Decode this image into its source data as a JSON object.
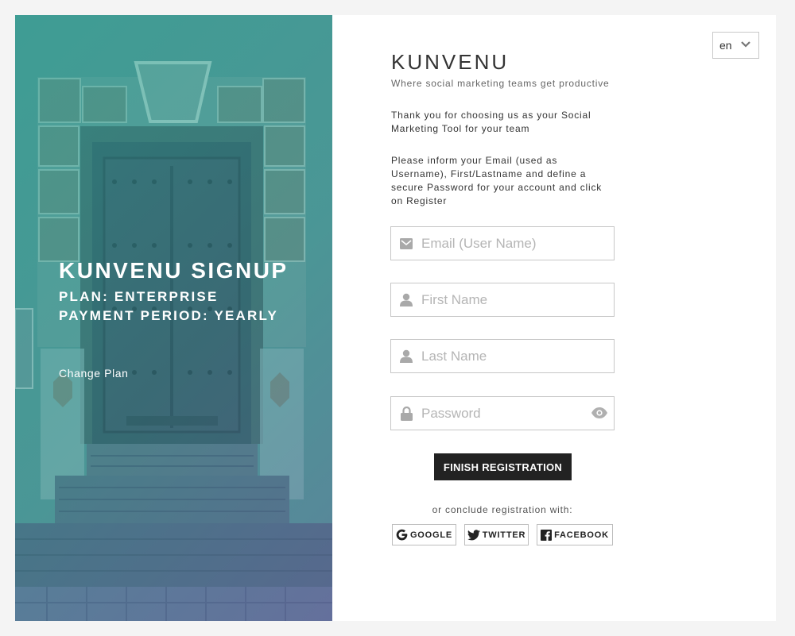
{
  "hero": {
    "title": "KUNVENU SIGNUP",
    "plan": "PLAN: ENTERPRISE",
    "period": "PAYMENT PERIOD: YEARLY",
    "change_plan": "Change Plan"
  },
  "language": {
    "selected": "en",
    "icon": "chevron-down-icon"
  },
  "brand": {
    "name": "KUNVENU",
    "tagline": "Where social marketing teams get productive"
  },
  "intro": "Thank you for choosing us as your Social Marketing Tool for your team",
  "instructions": "Please inform your Email (used as Username), First/Lastname and define a secure Password for your account and click on Register",
  "form": {
    "email": {
      "placeholder": "Email (User Name)",
      "value": "",
      "icon": "envelope-icon"
    },
    "first_name": {
      "placeholder": "First Name",
      "value": "",
      "icon": "user-icon"
    },
    "last_name": {
      "placeholder": "Last Name",
      "value": "",
      "icon": "user-icon"
    },
    "password": {
      "placeholder": "Password",
      "value": "",
      "icon": "lock-icon",
      "toggle_icon": "eye-icon"
    },
    "submit_label": "FINISH REGISTRATION"
  },
  "social": {
    "prompt": "or conclude registration with:",
    "google": "GOOGLE",
    "twitter": "TWITTER",
    "facebook": "FACEBOOK"
  },
  "colors": {
    "accent_dark": "#222222",
    "hero_tint_start": "#3f8f8a",
    "hero_tint_end": "#5d7f94",
    "border": "#c7c7c7"
  }
}
